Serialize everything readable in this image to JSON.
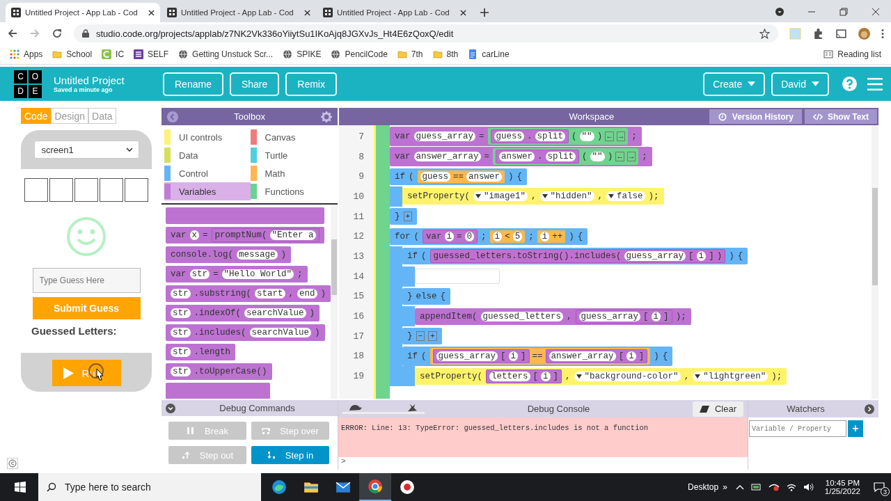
{
  "browser": {
    "tabs": [
      {
        "title": "Untitled Project - App Lab - Cod",
        "selected": true
      },
      {
        "title": "Untitled Project - App Lab - Cod",
        "selected": false
      },
      {
        "title": "Untitled Project - App Lab - Cod",
        "selected": false
      }
    ],
    "url": "studio.code.org/projects/applab/z7NK2Vk336oYiiytSu1IKoAjq8JGXvJs_Ht4E6zQoxQ/edit",
    "bookmarks": [
      {
        "label": "Apps",
        "kind": "apps"
      },
      {
        "label": "School",
        "kind": "folder"
      },
      {
        "label": "IC",
        "kind": "square"
      },
      {
        "label": "SELF",
        "kind": "list"
      },
      {
        "label": "Getting Unstuck Scr...",
        "kind": "globe"
      },
      {
        "label": "SPIKE",
        "kind": "globe"
      },
      {
        "label": "PencilCode",
        "kind": "globe"
      },
      {
        "label": "7th",
        "kind": "folder"
      },
      {
        "label": "8th",
        "kind": "folder"
      },
      {
        "label": "carLine",
        "kind": "doc"
      }
    ],
    "reading_list": "Reading list"
  },
  "header": {
    "logo_letters": [
      "C",
      "O",
      "D",
      "E"
    ],
    "title": "Untitled Project",
    "saved": "Saved a minute ago",
    "buttons": [
      "Rename",
      "Share",
      "Remix"
    ],
    "menus": [
      "Create",
      "David"
    ]
  },
  "mode_tabs": [
    {
      "label": "Code",
      "selected": true
    },
    {
      "label": "Design",
      "selected": false
    },
    {
      "label": "Data",
      "selected": false
    }
  ],
  "app_preview": {
    "screen": "screen1",
    "input_placeholder": "Type Guess Here",
    "submit": "Submit Guess",
    "guessed_label": "Guessed Letters:",
    "run": "Ru"
  },
  "toolbox": {
    "title": "Toolbox",
    "categories": [
      {
        "label": "UI controls",
        "color": "#fff176",
        "selected": false
      },
      {
        "label": "Canvas",
        "color": "#f07b7b",
        "selected": false
      },
      {
        "label": "Data",
        "color": "#d4e157",
        "selected": false
      },
      {
        "label": "Turtle",
        "color": "#4dd0e1",
        "selected": false
      },
      {
        "label": "Control",
        "color": "#64b5f6",
        "selected": false
      },
      {
        "label": "Math",
        "color": "#ffb74d",
        "selected": false
      },
      {
        "label": "Variables",
        "color": "#c27bd8",
        "selected": true
      },
      {
        "label": "Functions",
        "color": "#68d391",
        "selected": false
      }
    ],
    "blocks": [
      [
        {
          "kind": "word",
          "text": "var"
        },
        {
          "kind": "slot",
          "text": "x"
        },
        {
          "kind": "word",
          "text": "="
        },
        {
          "kind": "variable",
          "parts": [
            {
              "kind": "word",
              "text": "promptNum("
            },
            {
              "kind": "slot",
              "text": "\"Enter a"
            }
          ]
        }
      ],
      [
        {
          "kind": "word",
          "text": "console.log("
        },
        {
          "kind": "slot",
          "text": "message"
        },
        {
          "kind": "word",
          "text": ")"
        }
      ],
      [
        {
          "kind": "word",
          "text": "var"
        },
        {
          "kind": "slot",
          "text": "str"
        },
        {
          "kind": "word",
          "text": "="
        },
        {
          "kind": "slot",
          "text": "\"Hello World\""
        },
        {
          "kind": "word",
          "text": ";"
        }
      ],
      [
        {
          "kind": "slot",
          "text": "str"
        },
        {
          "kind": "word",
          "text": ".substring("
        },
        {
          "kind": "slot",
          "text": "start"
        },
        {
          "kind": "word",
          "text": ","
        },
        {
          "kind": "slot",
          "text": "end"
        },
        {
          "kind": "word",
          "text": ")"
        }
      ],
      [
        {
          "kind": "slot",
          "text": "str"
        },
        {
          "kind": "word",
          "text": ".indexOf("
        },
        {
          "kind": "slot",
          "text": "searchValue"
        },
        {
          "kind": "word",
          "text": ")"
        }
      ],
      [
        {
          "kind": "slot",
          "text": "str"
        },
        {
          "kind": "word",
          "text": ".includes("
        },
        {
          "kind": "slot",
          "text": "searchValue"
        },
        {
          "kind": "word",
          "text": ")"
        }
      ],
      [
        {
          "kind": "slot",
          "text": "str"
        },
        {
          "kind": "word",
          "text": ".length"
        }
      ],
      [
        {
          "kind": "slot",
          "text": "str"
        },
        {
          "kind": "word",
          "text": ".toUpperCase()"
        }
      ]
    ]
  },
  "workspace": {
    "title": "Workspace",
    "buttons": [
      "Version History",
      "Show Text"
    ],
    "blocks": [
      {
        "kind": "variable",
        "line": "7",
        "parts": [
          {
            "kind": "word",
            "text": "var"
          },
          {
            "kind": "slot",
            "text": "guess_array"
          },
          {
            "kind": "word",
            "text": "="
          },
          {
            "kind": "string",
            "parts": [
              {
                "kind": "variable",
                "parts": [
                  {
                    "kind": "slot",
                    "text": "guess"
                  },
                  {
                    "kind": "word",
                    "text": "."
                  },
                  {
                    "kind": "slot",
                    "text": "split"
                  }
                ]
              },
              {
                "kind": "word",
                "text": "("
              },
              {
                "kind": "slot",
                "text": "\"\""
              },
              {
                "kind": "word",
                "text": ")"
              },
              {
                "kind": "button",
                "text": "←"
              },
              {
                "kind": "button",
                "text": "→"
              }
            ]
          },
          {
            "kind": "word",
            "text": ";"
          }
        ]
      },
      {
        "kind": "variable",
        "line": "8",
        "parts": [
          {
            "kind": "word",
            "text": "var"
          },
          {
            "kind": "slot",
            "text": "answer_array"
          },
          {
            "kind": "word",
            "text": "="
          },
          {
            "kind": "string",
            "parts": [
              {
                "kind": "variable",
                "parts": [
                  {
                    "kind": "slot",
                    "text": "answer"
                  },
                  {
                    "kind": "word",
                    "text": "."
                  },
                  {
                    "kind": "slot",
                    "text": "split"
                  }
                ]
              },
              {
                "kind": "word",
                "text": "("
              },
              {
                "kind": "slot",
                "text": "\"\""
              },
              {
                "kind": "word",
                "text": ")"
              },
              {
                "kind": "button",
                "text": "←"
              },
              {
                "kind": "button",
                "text": "→"
              }
            ]
          },
          {
            "kind": "word",
            "text": ";"
          }
        ]
      },
      {
        "kind": "control",
        "rows": [
          {
            "line": "9",
            "parts": [
              {
                "kind": "word",
                "text": "if"
              },
              {
                "kind": "word",
                "text": "("
              },
              {
                "kind": "math",
                "parts": [
                  {
                    "kind": "slot",
                    "text": "guess"
                  },
                  {
                    "kind": "word",
                    "text": "=="
                  },
                  {
                    "kind": "slot",
                    "text": "answer"
                  }
                ]
              },
              {
                "kind": "word",
                "text": ")"
              },
              {
                "kind": "word",
                "text": "{"
              }
            ],
            "children": [
              {
                "kind": "ui",
                "line": "10",
                "parts": [
                  {
                    "kind": "word",
                    "text": "setProperty("
                  },
                  {
                    "kind": "dropdown",
                    "text": "\"image1\""
                  },
                  {
                    "kind": "word",
                    "text": ","
                  },
                  {
                    "kind": "dropdown",
                    "text": "\"hidden\""
                  },
                  {
                    "kind": "word",
                    "text": ","
                  },
                  {
                    "kind": "dropdown",
                    "text": "false"
                  },
                  {
                    "kind": "word",
                    "text": ");"
                  }
                ]
              }
            ]
          },
          {
            "line": "11",
            "parts": [
              {
                "kind": "word",
                "text": "}"
              },
              {
                "kind": "button",
                "text": "+"
              }
            ]
          }
        ]
      },
      {
        "kind": "control",
        "rows": [
          {
            "line": "12",
            "parts": [
              {
                "kind": "word",
                "text": "for"
              },
              {
                "kind": "word",
                "text": "("
              },
              {
                "kind": "variable",
                "parts": [
                  {
                    "kind": "word",
                    "text": "var"
                  },
                  {
                    "kind": "slot",
                    "text": "i"
                  },
                  {
                    "kind": "word",
                    "text": "="
                  },
                  {
                    "kind": "slot",
                    "text": "0"
                  }
                ]
              },
              {
                "kind": "word",
                "text": ";"
              },
              {
                "kind": "math",
                "parts": [
                  {
                    "kind": "slot",
                    "text": "i"
                  },
                  {
                    "kind": "word",
                    "text": "<"
                  },
                  {
                    "kind": "slot",
                    "text": "5"
                  }
                ]
              },
              {
                "kind": "word",
                "text": ";"
              },
              {
                "kind": "math",
                "parts": [
                  {
                    "kind": "slot",
                    "text": "i"
                  },
                  {
                    "kind": "word",
                    "text": "++"
                  }
                ]
              },
              {
                "kind": "word",
                "text": ")"
              },
              {
                "kind": "word",
                "text": "{"
              }
            ],
            "children": [
              {
                "kind": "control",
                "rows": [
                  {
                    "line": "13",
                    "parts": [
                      {
                        "kind": "word",
                        "text": "if"
                      },
                      {
                        "kind": "word",
                        "text": "("
                      },
                      {
                        "kind": "variable",
                        "parts": [
                          {
                            "kind": "word",
                            "text": "guessed_letters.toString().includes("
                          },
                          {
                            "kind": "slot",
                            "text": "guess_array"
                          },
                          {
                            "kind": "word",
                            "text": "["
                          },
                          {
                            "kind": "slot",
                            "text": "i"
                          },
                          {
                            "kind": "word",
                            "text": "]"
                          },
                          {
                            "kind": "word",
                            "text": ")"
                          }
                        ]
                      },
                      {
                        "kind": "word",
                        "text": ")"
                      },
                      {
                        "kind": "word",
                        "text": "{"
                      }
                    ],
                    "children": [
                      {
                        "kind": "empty",
                        "line": "14"
                      }
                    ]
                  },
                  {
                    "line": "15",
                    "parts": [
                      {
                        "kind": "word",
                        "text": "}"
                      },
                      {
                        "kind": "word",
                        "text": "else"
                      },
                      {
                        "kind": "word",
                        "text": "{"
                      }
                    ],
                    "children": [
                      {
                        "kind": "variable",
                        "line": "16",
                        "parts": [
                          {
                            "kind": "word",
                            "text": "appendItem("
                          },
                          {
                            "kind": "slot",
                            "text": "guessed_letters"
                          },
                          {
                            "kind": "word",
                            "text": ","
                          },
                          {
                            "kind": "variable",
                            "parts": [
                              {
                                "kind": "slot",
                                "text": "guess_array"
                              },
                              {
                                "kind": "word",
                                "text": "["
                              },
                              {
                                "kind": "slot",
                                "text": "i"
                              },
                              {
                                "kind": "word",
                                "text": "]"
                              }
                            ]
                          },
                          {
                            "kind": "word",
                            "text": ");"
                          }
                        ]
                      }
                    ]
                  },
                  {
                    "line": "17",
                    "parts": [
                      {
                        "kind": "word",
                        "text": "}"
                      },
                      {
                        "kind": "button",
                        "text": "−"
                      },
                      {
                        "kind": "button",
                        "text": "+"
                      }
                    ]
                  }
                ]
              },
              {
                "kind": "control",
                "rows": [
                  {
                    "line": "18",
                    "parts": [
                      {
                        "kind": "word",
                        "text": "if"
                      },
                      {
                        "kind": "word",
                        "text": "("
                      },
                      {
                        "kind": "math",
                        "parts": [
                          {
                            "kind": "variable",
                            "parts": [
                              {
                                "kind": "slot",
                                "text": "guess_array"
                              },
                              {
                                "kind": "word",
                                "text": "["
                              },
                              {
                                "kind": "slot",
                                "text": "i"
                              },
                              {
                                "kind": "word",
                                "text": "]"
                              }
                            ]
                          },
                          {
                            "kind": "word",
                            "text": "=="
                          },
                          {
                            "kind": "variable",
                            "parts": [
                              {
                                "kind": "slot",
                                "text": "answer_array"
                              },
                              {
                                "kind": "word",
                                "text": "["
                              },
                              {
                                "kind": "slot",
                                "text": "i"
                              },
                              {
                                "kind": "word",
                                "text": "]"
                              }
                            ]
                          }
                        ]
                      },
                      {
                        "kind": "word",
                        "text": ")"
                      },
                      {
                        "kind": "word",
                        "text": "{"
                      }
                    ],
                    "children": [
                      {
                        "kind": "ui",
                        "line": "19",
                        "parts": [
                          {
                            "kind": "word",
                            "text": "setProperty("
                          },
                          {
                            "kind": "variable",
                            "parts": [
                              {
                                "kind": "slot",
                                "text": "letters"
                              },
                              {
                                "kind": "word",
                                "text": "["
                              },
                              {
                                "kind": "slot",
                                "text": "i"
                              },
                              {
                                "kind": "word",
                                "text": "]"
                              }
                            ]
                          },
                          {
                            "kind": "word",
                            "text": ","
                          },
                          {
                            "kind": "dropdown",
                            "text": "\"background-color\""
                          },
                          {
                            "kind": "word",
                            "text": ","
                          },
                          {
                            "kind": "dropdown",
                            "text": "\"lightgreen\""
                          },
                          {
                            "kind": "word",
                            "text": ");"
                          }
                        ]
                      }
                    ]
                  }
                ]
              }
            ]
          }
        ]
      }
    ]
  },
  "debug": {
    "commands_title": "Debug Commands",
    "commands": [
      {
        "label": "Break",
        "kind": "pause",
        "disabled": true
      },
      {
        "label": "Step over",
        "kind": "over",
        "disabled": true
      },
      {
        "label": "Step out",
        "kind": "out",
        "disabled": true
      },
      {
        "label": "Step in",
        "kind": "in",
        "disabled": false
      }
    ],
    "console_title": "Debug Console",
    "speed": {
      "level": 1
    },
    "clear": "Clear",
    "error": "ERROR: Line: 13: TypeError: guessed_letters.includes is not a function",
    "prompt": ">",
    "watchers_title": "Watchers",
    "watch_placeholder": "Variable / Property",
    "add": "+"
  },
  "taskbar": {
    "search_placeholder": "Type here to search",
    "apps": [
      {
        "kind": "edge",
        "selected": false
      },
      {
        "kind": "folder",
        "selected": false
      },
      {
        "kind": "mail",
        "selected": false
      },
      {
        "kind": "chrome",
        "selected": true
      },
      {
        "kind": "record",
        "selected": false
      }
    ],
    "desktop": "Desktop",
    "more": "»",
    "time": "10:45 PM",
    "date": "1/25/2022",
    "notifications": "3"
  }
}
